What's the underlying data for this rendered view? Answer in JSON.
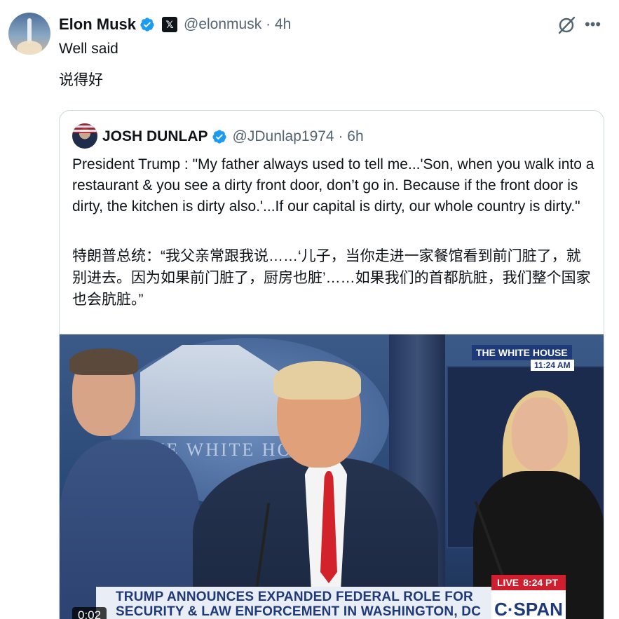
{
  "post": {
    "author_name": "Elon Musk",
    "author_handle": "@elonmusk",
    "time": "· 4h",
    "x_badge": "𝕏",
    "text_lines": [
      "Well said",
      "说得好"
    ]
  },
  "quote": {
    "author_name": "JOSH DUNLAP",
    "author_handle": "@JDunlap1974",
    "time": "· 6h",
    "text_en": "President Trump : \"My father always used to tell me...'Son, when you walk into a restaurant & you see a dirty front door, don’t go in. Because if the front door is dirty, the kitchen is dirty also.'...If our capital is dirty, our whole country is dirty.\"",
    "text_zh": "特朗普总统：“我父亲常跟我说……‘儿子，当你走进一家餐馆看到前门脏了，就别进去。因为如果前门脏了，厨房也脏’……如果我们的首都肮脏，我们整个国家也会肮脏。”"
  },
  "video": {
    "seal_text": "THE WHITE HO",
    "wh_badge": "THE WHITE HOUSE",
    "wh_time": "11:24 AM",
    "live_label": "LIVE",
    "live_time": "8:24 PT",
    "network": "C·SPAN",
    "chyron_line1": "TRUMP ANNOUNCES EXPANDED FEDERAL ROLE FOR",
    "chyron_line2": "SECURITY & LAW ENFORCEMENT IN WASHINGTON, DC",
    "timecode": "0:02"
  },
  "icons": {
    "verified": "verified-badge-icon",
    "grok": "grok-icon",
    "more": "more-icon"
  },
  "colors": {
    "verified_blue": "#1d9bf0",
    "text": "#0f1419",
    "secondary": "#536471",
    "border": "#cfd9de",
    "cspan_blue": "#1f3a78",
    "live_red": "#cf1f2f"
  }
}
